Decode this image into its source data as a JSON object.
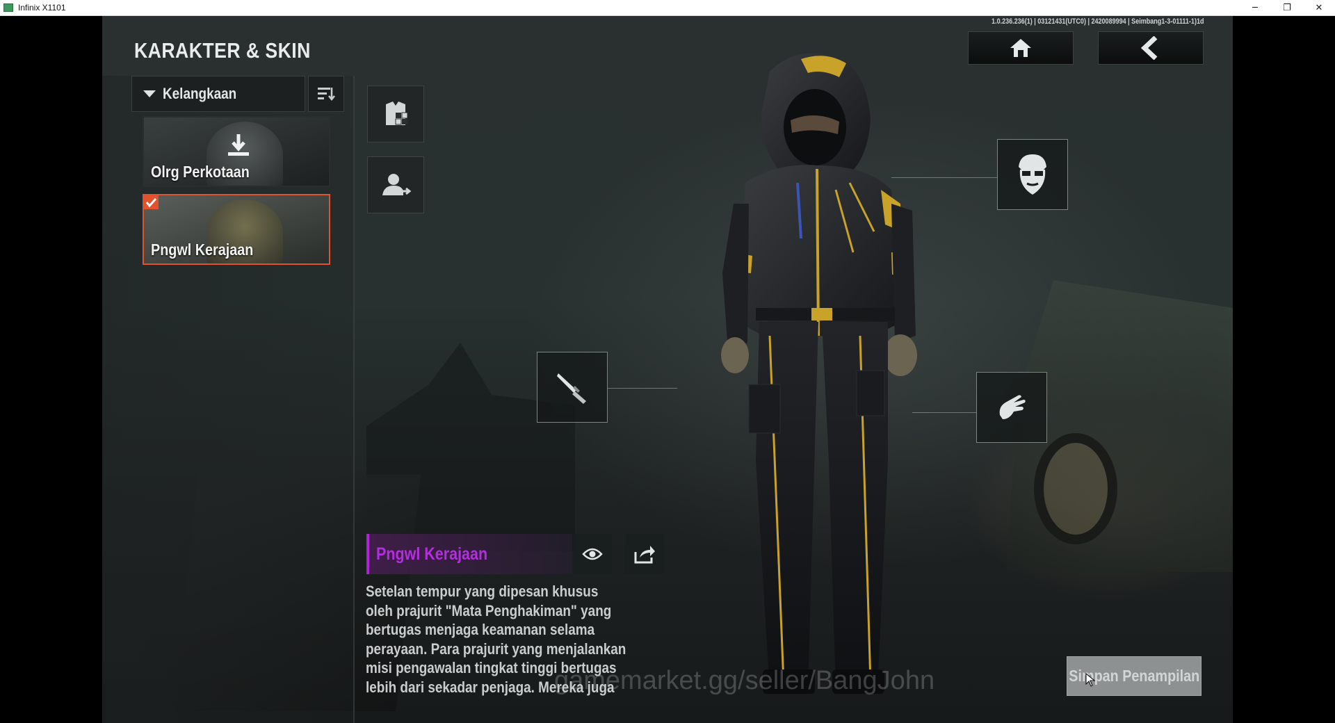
{
  "window": {
    "title": "Infinix X1101",
    "controls": {
      "minimize": "─",
      "restore": "❐",
      "close": "✕"
    }
  },
  "header": {
    "title": "KARAKTER & SKIN",
    "version_info": "1.0.236.236(1) | 03121431(UTC0) | 2420089994 | Seimbang1-3-01111-1)1d"
  },
  "filter": {
    "sort_label": "Kelangkaan"
  },
  "skins": [
    {
      "name": "Olrg Perkotaan",
      "selected": false,
      "downloadable": true
    },
    {
      "name": "Pngwl Kerajaan",
      "selected": true,
      "downloadable": false
    }
  ],
  "item": {
    "name": "Pngwl Kerajaan",
    "name_color": "#b42ee0",
    "description": "Setelan tempur yang dipesan khusus oleh prajurit \"Mata Penghakiman\" yang bertugas menjaga keamanan selama perayaan. Para prajurit yang menjalankan misi pengawalan tingkat tinggi bertugas lebih dari sekadar penjaga. Mereka juga menjadi pemandangan"
  },
  "watermark": "gamemarket.gg/seller/BangJohn",
  "actions": {
    "save_label": "Simpan Penampilan"
  },
  "colors": {
    "selected_border": "#e0532c",
    "rarity_accent": "#b020d8"
  },
  "icons": [
    "home-icon",
    "back-arrow-icon",
    "sort-icon",
    "outfit-icon",
    "character-swap-icon",
    "download-icon",
    "checkmark-icon",
    "eye-icon",
    "share-icon",
    "mask-icon",
    "glove-icon",
    "knife-icon"
  ]
}
